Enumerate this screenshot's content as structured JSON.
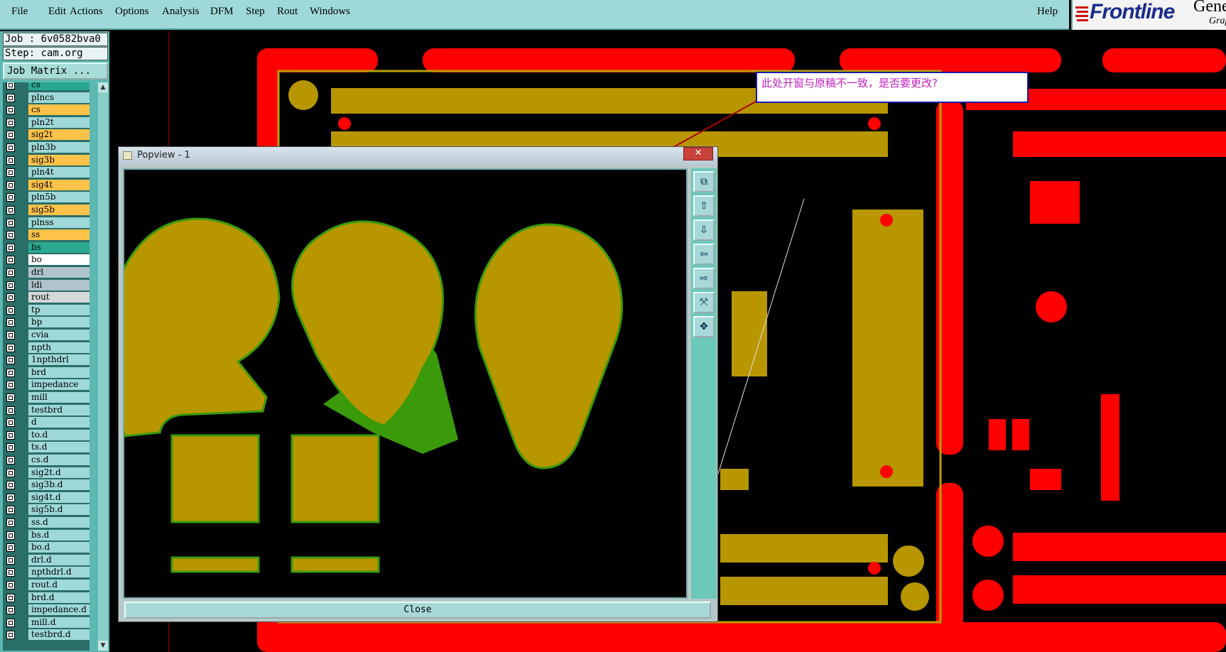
{
  "menu": {
    "items": [
      "File",
      "Edit",
      "Actions",
      "Options",
      "Analysis",
      "DFM",
      "Step",
      "Rout",
      "Windows"
    ],
    "help": "Help"
  },
  "brand": {
    "logo": "Frontline",
    "gen": "Gene",
    "sub": "Grap"
  },
  "job": {
    "job_line": "Job : 6v0582bva0",
    "step_line": "Step: cam.org",
    "matrix_button": "Job Matrix ..."
  },
  "layers": [
    {
      "name": "cs",
      "color": "#2aa890"
    },
    {
      "name": "plncs",
      "color": "#9fd8d8"
    },
    {
      "name": "cs",
      "color": "#ffc34a"
    },
    {
      "name": "pln2t",
      "color": "#9fd8d8"
    },
    {
      "name": "sig2t",
      "color": "#ffc34a"
    },
    {
      "name": "pln3b",
      "color": "#9fd8d8"
    },
    {
      "name": "sig3b",
      "color": "#ffc34a"
    },
    {
      "name": "pln4t",
      "color": "#9fd8d8"
    },
    {
      "name": "sig4t",
      "color": "#ffc34a"
    },
    {
      "name": "pln5b",
      "color": "#9fd8d8"
    },
    {
      "name": "sig5b",
      "color": "#ffc34a"
    },
    {
      "name": "plnss",
      "color": "#9fd8d8"
    },
    {
      "name": "ss",
      "color": "#ffc34a"
    },
    {
      "name": "bs",
      "color": "#2aa890"
    },
    {
      "name": "bo",
      "color": "#ffffff"
    },
    {
      "name": "drl",
      "color": "#b0c4cc"
    },
    {
      "name": "ldi",
      "color": "#b0c4cc"
    },
    {
      "name": "rout",
      "color": "#d4d8d8"
    },
    {
      "name": "tp",
      "color": "#9fd8d8"
    },
    {
      "name": "bp",
      "color": "#9fd8d8"
    },
    {
      "name": "cvia",
      "color": "#9fd8d8"
    },
    {
      "name": "npth",
      "color": "#9fd8d8"
    },
    {
      "name": "1npthdrl",
      "color": "#9fd8d8"
    },
    {
      "name": "brd",
      "color": "#9fd8d8"
    },
    {
      "name": "impedance",
      "color": "#9fd8d8"
    },
    {
      "name": "mill",
      "color": "#9fd8d8"
    },
    {
      "name": "testbrd",
      "color": "#9fd8d8"
    },
    {
      "name": "d",
      "color": "#9fd8d8"
    },
    {
      "name": "to.d",
      "color": "#9fd8d8"
    },
    {
      "name": "ts.d",
      "color": "#9fd8d8"
    },
    {
      "name": "cs.d",
      "color": "#9fd8d8"
    },
    {
      "name": "sig2t.d",
      "color": "#9fd8d8"
    },
    {
      "name": "sig3b.d",
      "color": "#9fd8d8"
    },
    {
      "name": "sig4t.d",
      "color": "#9fd8d8"
    },
    {
      "name": "sig5b.d",
      "color": "#9fd8d8"
    },
    {
      "name": "ss.d",
      "color": "#9fd8d8"
    },
    {
      "name": "bs.d",
      "color": "#9fd8d8"
    },
    {
      "name": "bo.d",
      "color": "#9fd8d8"
    },
    {
      "name": "drl.d",
      "color": "#9fd8d8"
    },
    {
      "name": "npthdrl.d",
      "color": "#9fd8d8"
    },
    {
      "name": "rout.d",
      "color": "#9fd8d8"
    },
    {
      "name": "brd.d",
      "color": "#9fd8d8"
    },
    {
      "name": "impedance.d",
      "color": "#9fd8d8"
    },
    {
      "name": "mill.d",
      "color": "#9fd8d8"
    },
    {
      "name": "testbrd.d",
      "color": "#9fd8d8"
    }
  ],
  "comment": "此处开窗与原稿不一致，是否要更改?",
  "popview": {
    "title": "Popview - 1",
    "close_x": "✕",
    "close_button": "Close"
  },
  "colors": {
    "copper": "#b89600",
    "mask": "#3a9a0a",
    "board": "#ff0000",
    "background": "#000000"
  }
}
